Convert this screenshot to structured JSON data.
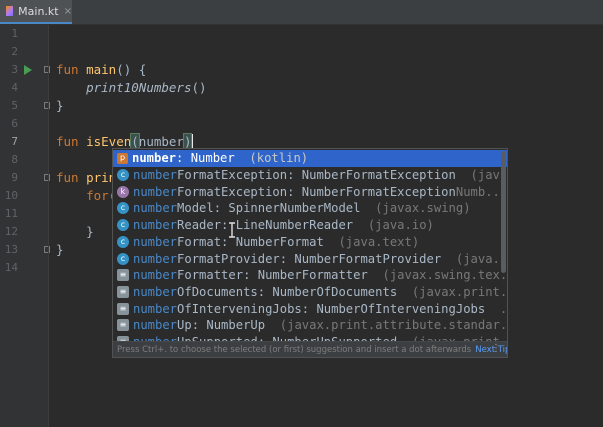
{
  "tab": {
    "label": "Main.kt",
    "close_icon": "×",
    "icon": "kotlin-file-icon"
  },
  "gutter": {
    "line_numbers": [
      "1",
      "2",
      "3",
      "4",
      "5",
      "6",
      "7",
      "8",
      "9",
      "10",
      "11",
      "12",
      "13",
      "14"
    ],
    "current_line": "7"
  },
  "code": {
    "line3": {
      "kw": "fun",
      "name": "main",
      "rest": "() {"
    },
    "line4": {
      "call": "print10Numbers",
      "rest": "()"
    },
    "line5": {
      "text": "}"
    },
    "line7": {
      "kw": "fun",
      "name": "isEven",
      "paren": "(",
      "text": "number",
      "close": ")"
    },
    "line9": {
      "kw": "fun",
      "name": "prin"
    },
    "line10": {
      "kw": "for",
      "rest": "("
    },
    "line12": {
      "text": "}"
    },
    "line13": {
      "text": "}"
    }
  },
  "completion": {
    "items": [
      {
        "icon": "p",
        "match": "number",
        "text": ": Number",
        "right": "(kotlin)",
        "far": ""
      },
      {
        "icon": "c",
        "match": "number",
        "text": "FormatException: NumberFormatException",
        "right": "(jav...",
        "far": ""
      },
      {
        "icon": "k",
        "match": "number",
        "text": "FormatException: NumberFormatException",
        "right": "",
        "far": "Numb..."
      },
      {
        "icon": "c",
        "match": "number",
        "text": "Model: SpinnerNumberModel",
        "right": "(javax.swing)",
        "far": ""
      },
      {
        "icon": "c",
        "match": "number",
        "text": "Reader: LineNumberReader",
        "right": "(java.io)",
        "far": ""
      },
      {
        "icon": "c",
        "match": "number",
        "text": "Format: NumberFormat",
        "right": "(java.text)",
        "far": ""
      },
      {
        "icon": "c",
        "match": "number",
        "text": "FormatProvider: NumberFormatProvider",
        "right": "(java...",
        "far": ""
      },
      {
        "icon": "x",
        "match": "number",
        "text": "Formatter: NumberFormatter",
        "right": "(javax.swing.tex...",
        "far": ""
      },
      {
        "icon": "x",
        "match": "number",
        "text": "OfDocuments: NumberOfDocuments",
        "right": "(javax.print...",
        "far": ""
      },
      {
        "icon": "x",
        "match": "number",
        "text": "OfInterveningJobs: NumberOfInterveningJobs",
        "right": "...",
        "far": ""
      },
      {
        "icon": "x",
        "match": "number",
        "text": "Up: NumberUp",
        "right": "(javax.print.attribute.standar...",
        "far": ""
      },
      {
        "icon": "x",
        "match": "number",
        "text": "UpSupported: NumberUpSupported",
        "right": "(javax.print...",
        "far": ""
      }
    ],
    "footer_hint": "Press Ctrl+. to choose the selected (or first) suggestion and insert a dot afterwards",
    "footer_tip": "Next Tip",
    "more_icon": "⋮"
  },
  "colors": {
    "background": "#2b2b2b",
    "keyword": "#cc7832",
    "function": "#ffc66d",
    "selection": "#2f65ca",
    "match": "#4a88c7"
  }
}
